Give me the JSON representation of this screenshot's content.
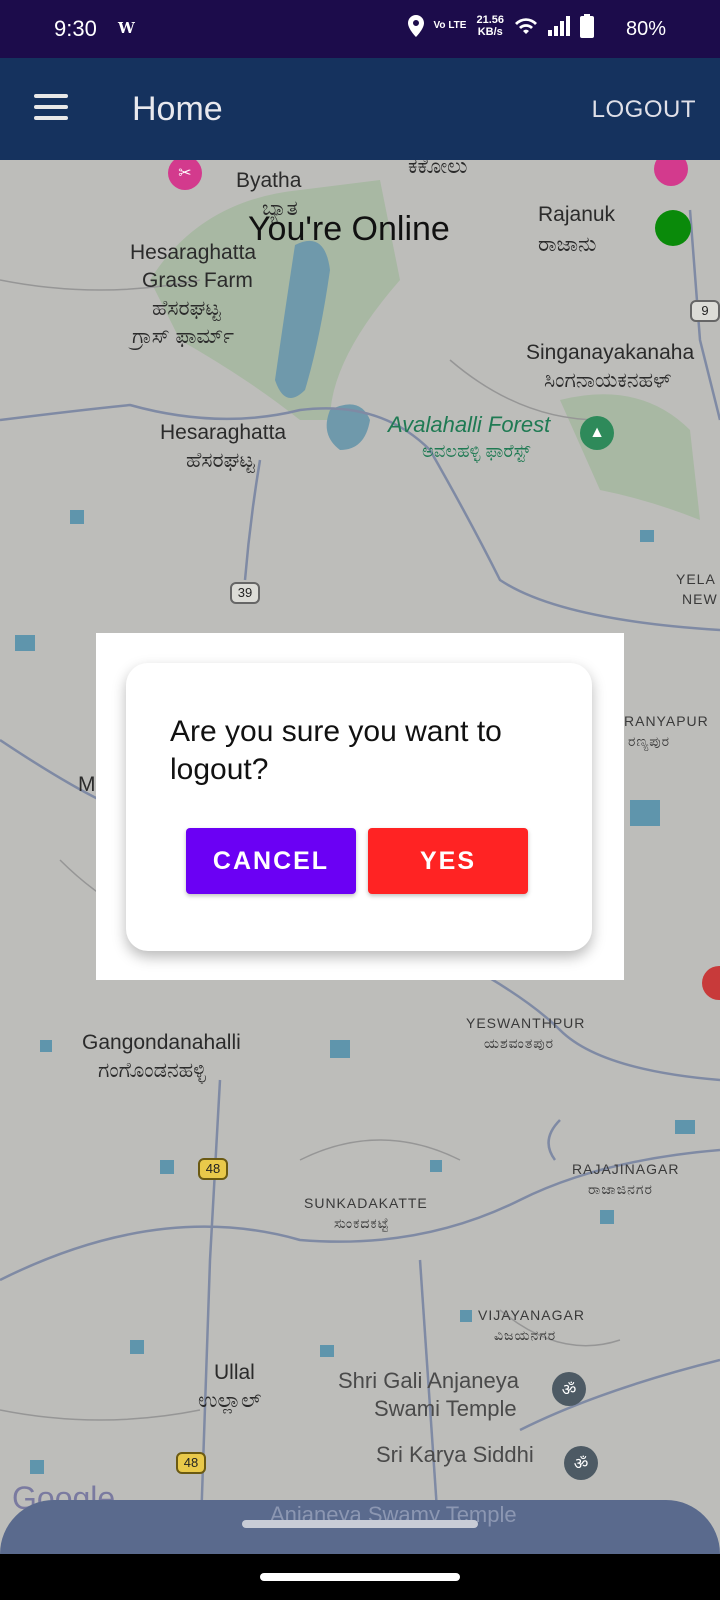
{
  "status_bar": {
    "time": "9:30",
    "carrier_logo": "W",
    "volte": "Vo LTE",
    "speed_value": "21.56",
    "speed_unit": "KB/s",
    "battery": "80%"
  },
  "app_bar": {
    "title": "Home",
    "logout_label": "LOGOUT",
    "menu_icon": "hamburger-menu-icon"
  },
  "map": {
    "online_text": "You're Online",
    "status_color": "#0a8a0a",
    "labels": {
      "byatha_en": "Byatha",
      "byatha_kn": "ಬ್ಯಾತ",
      "kakolu_kn": "ಕಕೋಲು",
      "rajanukunte_en": "Rajanuk",
      "rajanukunte_kn": "ರಾಜಾನು",
      "grass_farm_en1": "Hesaraghatta",
      "grass_farm_en2": "Grass Farm",
      "grass_farm_kn1": "ಹೆಸರಘಟ್ಟ",
      "grass_farm_kn2": "ಗ್ರಾಸ್ ಫಾರ್ಮ್",
      "singanayakanahalli_en": "Singanayakanaha",
      "singanayakanahalli_kn": "ಸಿಂಗನಾಯಕನಹಳ್",
      "hesaraghatta_en": "Hesaraghatta",
      "hesaraghatta_kn": "ಹೆಸರಘಟ್ಟ",
      "avalahalli_en": "Avalahalli Forest",
      "avalahalli_kn": "ಅವಲಹಳ್ಳಿ ಫಾರೆಸ್ಟ್",
      "yela_en": "YELA",
      "new_en": "NEW",
      "aranyapura_en": "RANYAPUR",
      "aranyapura_kn": "ರಣ್ಯಪುರ",
      "m_letter": "M",
      "gangondanahalli_en": "Gangondanahalli",
      "gangondanahalli_kn": "ಗಂಗೊಂಡನಹಳ್ಳಿ",
      "yeswanthpur_en": "YESWANTHPUR",
      "yeswanthpur_kn": "ಯಶವಂತಪುರ",
      "rajajinagar_en": "RAJAJINAGAR",
      "rajajinagar_kn": "ರಾಜಾಜಿನಗರ",
      "sunkadakatte_en": "SUNKADAKATTE",
      "sunkadakatte_kn": "ಸುಂಕದಕಟ್ಟೆ",
      "vijayanagar_en": "VIJAYANAGAR",
      "vijayanagar_kn": "ವಿಜಯನಗರ",
      "ullal_en": "Ullal",
      "ullal_kn": "ಉಲ್ಲಾಲ್",
      "gali_temple_1": "Shri Gali Anjaneya",
      "gali_temple_2": "Swami Temple",
      "karya_siddhi": "Sri Karya Siddhi",
      "google": "Google"
    },
    "shields": [
      "39",
      "48",
      "48",
      "9"
    ]
  },
  "dialog": {
    "message": "Are you sure you want to logout?",
    "cancel_label": "CANCEL",
    "yes_label": "YES",
    "cancel_color": "#6b00f4",
    "yes_color": "#ff2323"
  },
  "bottom_sheet": {
    "ghost_text": "Anjaneya Swamy Temple"
  }
}
